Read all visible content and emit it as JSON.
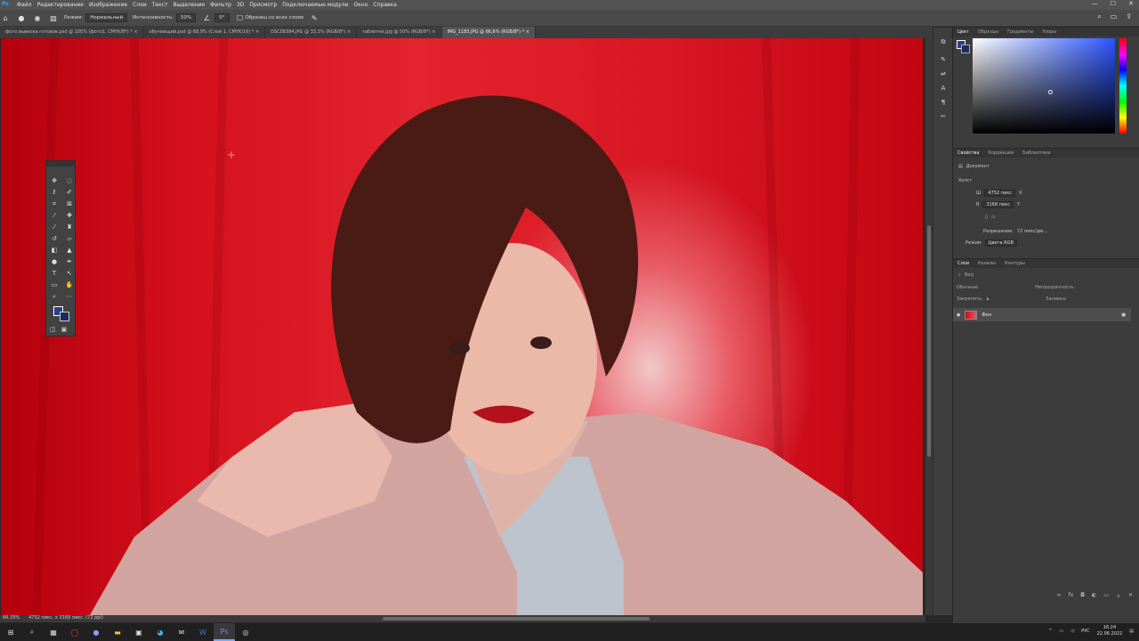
{
  "menubar": {
    "logo": "Ps",
    "items": [
      "Файл",
      "Редактирование",
      "Изображение",
      "Слои",
      "Текст",
      "Выделение",
      "Фильтр",
      "3D",
      "Просмотр",
      "Подключаемые модули",
      "Окно",
      "Справка"
    ],
    "win_min": "—",
    "win_max": "☐",
    "win_close": "✕"
  },
  "options": {
    "mode_label": "Режим:",
    "mode_value": "Нормальный",
    "intensity_label": "Интенсивность:",
    "intensity_value": "50%",
    "angle_value": "0°",
    "sample_label": "Образец со всех слоев"
  },
  "tabs": [
    {
      "label": "фото вывеска готовое.psd @ 100% (фото1, CMYK/8*) * ×"
    },
    {
      "label": "обучающий.psd @ 68,9% (Слой 1, CMYK/16) * ×"
    },
    {
      "label": "DSC08384.JPG @ 33,3% (RGB/8*) ×"
    },
    {
      "label": "таблетки.jpg @ 50% (RGB/8*) ×"
    },
    {
      "label": "IMG_1183.JPG @ 66,6% (RGB/8*) * ×"
    }
  ],
  "status": {
    "zoom": "66,33%",
    "size": "4752 пикс. x 3168 пикс. (72 ppi)"
  },
  "color_panel": {
    "tabs": [
      "Цвет",
      "Образцы",
      "Градиенты",
      "Узоры"
    ],
    "fg_color": "#2c3f8c",
    "bg_color": "#1e2a5a"
  },
  "props_panel": {
    "tabs": [
      "Свойства",
      "Коррекция",
      "Библиотеки"
    ],
    "doc_label": "Документ",
    "canvas_label": "Холст",
    "w_label": "Ш",
    "w_value": "4752 пикс",
    "x_label": "X",
    "h_label": "В",
    "h_value": "3168 пикс",
    "y_label": "Y",
    "resolution_label": "Разрешение:",
    "resolution_value": "72 пикс/дю...",
    "mode_label": "Режим",
    "mode_value": "Цвета RGB"
  },
  "layers_panel": {
    "tabs": [
      "Слои",
      "Каналы",
      "Контуры"
    ],
    "filter_label": "Вид",
    "blend_label": "Обычные",
    "opacity_label": "Непрозрачность:",
    "lock_label": "Закрепить:",
    "fill_label": "Заливка:",
    "layer_name": "Фон"
  },
  "taskbar": {
    "lang": "РУС",
    "time": "16:24",
    "date": "22.06.2022"
  }
}
